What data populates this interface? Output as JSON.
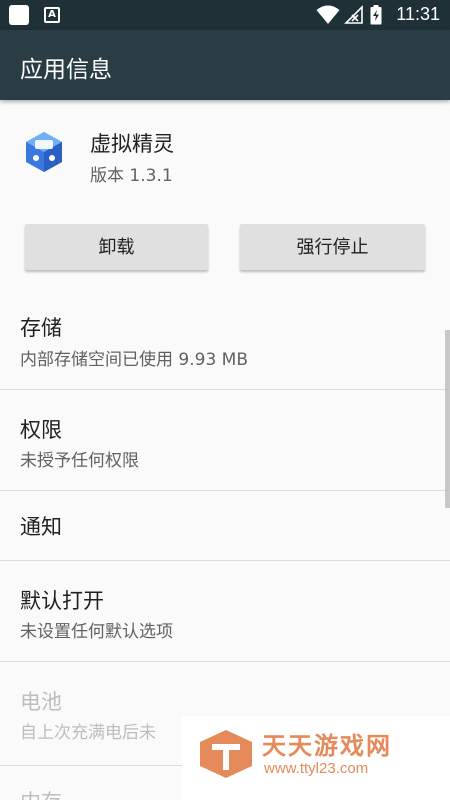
{
  "status_bar": {
    "time": "11:31",
    "notification_icons": [
      "square-notification-icon",
      "a-notification-icon"
    ],
    "system_icons": [
      "wifi-icon",
      "no-signal-icon",
      "battery-charging-icon"
    ]
  },
  "app_bar": {
    "title": "应用信息"
  },
  "app": {
    "name": "虚拟精灵",
    "version": "版本 1.3.1"
  },
  "buttons": {
    "uninstall": "卸载",
    "force_stop": "强行停止"
  },
  "sections": [
    {
      "title": "存储",
      "subtitle": "内部存储空间已使用 9.93 MB"
    },
    {
      "title": "权限",
      "subtitle": "未授予任何权限"
    },
    {
      "title": "通知",
      "subtitle": ""
    },
    {
      "title": "默认打开",
      "subtitle": "未设置任何默认选项"
    },
    {
      "title": "电池",
      "subtitle": "自上次充满电后未"
    },
    {
      "title": "内存",
      "subtitle": ""
    }
  ],
  "watermark": {
    "name": "天天游戏网",
    "url": "www.ttyl23.com"
  },
  "colors": {
    "status_bar": "#1f3036",
    "app_bar": "#2a3d44",
    "background": "#fafafa",
    "button": "#e0e0e0",
    "watermark": "#e58a5a"
  }
}
